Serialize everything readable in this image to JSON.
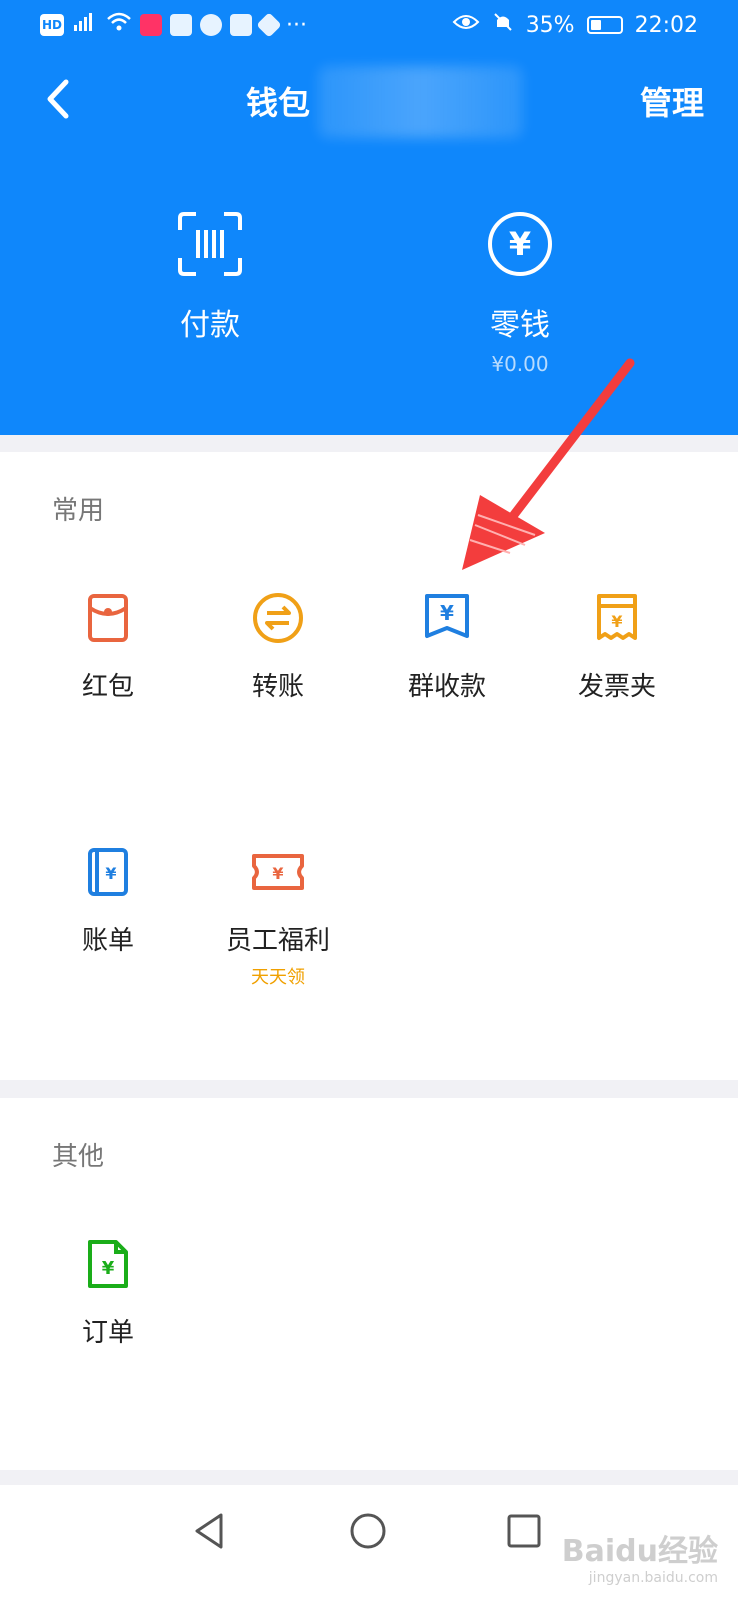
{
  "status_bar": {
    "left_icons": [
      "hd-icon",
      "signal-icon",
      "wifi-icon",
      "app-icon",
      "cloud-icon",
      "app2-icon",
      "app3-icon",
      "app4-icon",
      "more-icon"
    ],
    "battery": "35%",
    "time": "22:02"
  },
  "nav": {
    "title": "钱包",
    "manage_label": "管理"
  },
  "hero": {
    "pay_label": "付款",
    "change_label": "零钱",
    "change_amount": "¥0.00"
  },
  "common": {
    "title": "常用",
    "items": [
      {
        "label": "红包",
        "icon": "red-envelope-icon",
        "color": "#e9653f"
      },
      {
        "label": "转账",
        "icon": "transfer-icon",
        "color": "#f0a017"
      },
      {
        "label": "群收款",
        "icon": "group-collect-icon",
        "color": "#1f7fe0"
      },
      {
        "label": "发票夹",
        "icon": "invoice-icon",
        "color": "#f0a017"
      },
      {
        "label": "账单",
        "icon": "bill-icon",
        "color": "#1f7fe0"
      },
      {
        "label": "员工福利",
        "sub": "天天领",
        "icon": "benefit-ticket-icon",
        "color": "#e9653f"
      }
    ]
  },
  "other": {
    "title": "其他",
    "items": [
      {
        "label": "订单",
        "icon": "order-icon",
        "color": "#1aad19"
      }
    ]
  },
  "watermark": {
    "brand": "Baidu经验",
    "url": "jingyan.baidu.com"
  },
  "colors": {
    "header_bg": "#0f87fb",
    "annotation_arrow": "#f33d3d"
  }
}
